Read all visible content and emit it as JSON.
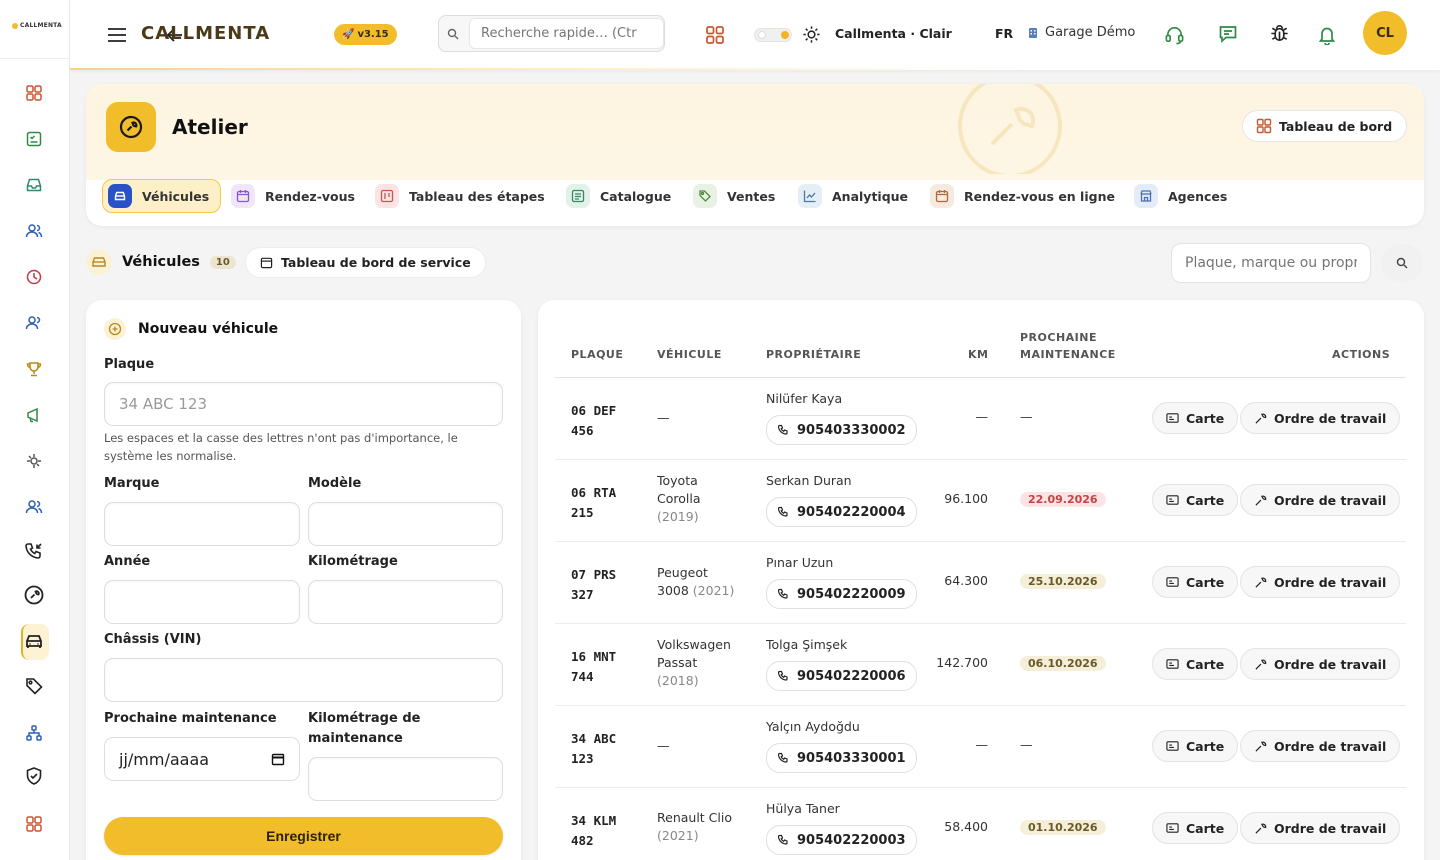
{
  "app": {
    "logo": "CALLMENTA"
  },
  "topbar": {
    "brand": "CALLMENTA",
    "version": "v3.15",
    "search_placeholder": "Recherche rapide… (Ctr",
    "theme_label": "Callmenta · Clair",
    "lang": "FR",
    "garage": "Garage Démo",
    "avatar": "CL"
  },
  "hero": {
    "title": "Atelier",
    "dashboard_button": "Tableau de bord",
    "tabs": [
      {
        "label": "Véhicules",
        "icon": "car-icon",
        "active": true
      },
      {
        "label": "Rendez-vous",
        "icon": "calendar-icon"
      },
      {
        "label": "Tableau des étapes",
        "icon": "board-icon"
      },
      {
        "label": "Catalogue",
        "icon": "catalog-icon"
      },
      {
        "label": "Ventes",
        "icon": "tag-icon"
      },
      {
        "label": "Analytique",
        "icon": "chart-icon"
      },
      {
        "label": "Rendez-vous en ligne",
        "icon": "calendar-icon"
      },
      {
        "label": "Agences",
        "icon": "store-icon"
      }
    ]
  },
  "section": {
    "title": "Véhicules",
    "count": "10",
    "service_button": "Tableau de bord de service",
    "search_placeholder": "Plaque, marque ou propri"
  },
  "form": {
    "title": "Nouveau véhicule",
    "plate_label": "Plaque",
    "plate_placeholder": "34 ABC 123",
    "plate_hint": "Les espaces et la casse des lettres n'ont pas d'importance, le système les normalise.",
    "brand_label": "Marque",
    "model_label": "Modèle",
    "year_label": "Année",
    "mileage_label": "Kilométrage",
    "vin_label": "Châssis (VIN)",
    "next_maint_label": "Prochaine maintenance",
    "next_maint_value": "jj/mm/aaaa",
    "maint_km_label": "Kilométrage de maintenance",
    "save_label": "Enregistrer"
  },
  "table": {
    "headers": {
      "plate": "PLAQUE",
      "vehicle": "VÉHICULE",
      "owner": "PROPRIÉTAIRE",
      "km": "KM",
      "maint": "PROCHAINE MAINTENANCE",
      "actions": "ACTIONS"
    },
    "card_label": "Carte",
    "order_label": "Ordre de travail",
    "rows": [
      {
        "plate1": "06 DEF",
        "plate2": "456",
        "vehicle1": "—",
        "vehicle2": "",
        "year": "",
        "owner": "Nilüfer Kaya",
        "phone": "905403330002",
        "km": "—",
        "maint": "—",
        "status": "none"
      },
      {
        "plate1": "06 RTA",
        "plate2": "215",
        "vehicle1": "Toyota",
        "vehicle2": "Corolla",
        "year": "(2019)",
        "owner": "Serkan Duran",
        "phone": "905402220004",
        "km": "96.100",
        "maint": "22.09.2026",
        "status": "red"
      },
      {
        "plate1": "07 PRS",
        "plate2": "327",
        "vehicle1": "Peugeot",
        "vehicle2": "3008",
        "year": "(2021)",
        "owner": "Pınar Uzun",
        "phone": "905402220009",
        "km": "64.300",
        "maint": "25.10.2026",
        "status": "yellow"
      },
      {
        "plate1": "16 MNT",
        "plate2": "744",
        "vehicle1": "Volkswagen",
        "vehicle2": "Passat",
        "year": "(2018)",
        "owner": "Tolga Şimşek",
        "phone": "905402220006",
        "km": "142.700",
        "maint": "06.10.2026",
        "status": "yellow"
      },
      {
        "plate1": "34 ABC",
        "plate2": "123",
        "vehicle1": "—",
        "vehicle2": "",
        "year": "",
        "owner": "Yalçın Aydoğdu",
        "phone": "905403330001",
        "km": "—",
        "maint": "—",
        "status": "none"
      },
      {
        "plate1": "34 KLM",
        "plate2": "482",
        "vehicle1": "Renault Clio",
        "vehicle2": "",
        "year": "(2021)",
        "owner": "Hülya Taner",
        "phone": "905402220003",
        "km": "58.400",
        "maint": "01.10.2026",
        "status": "yellow"
      }
    ]
  },
  "colors": {
    "accent": "#f2bd2a",
    "danger_bg": "#fde3e3",
    "danger_text": "#c24444",
    "warn_bg": "#f5eed8"
  }
}
